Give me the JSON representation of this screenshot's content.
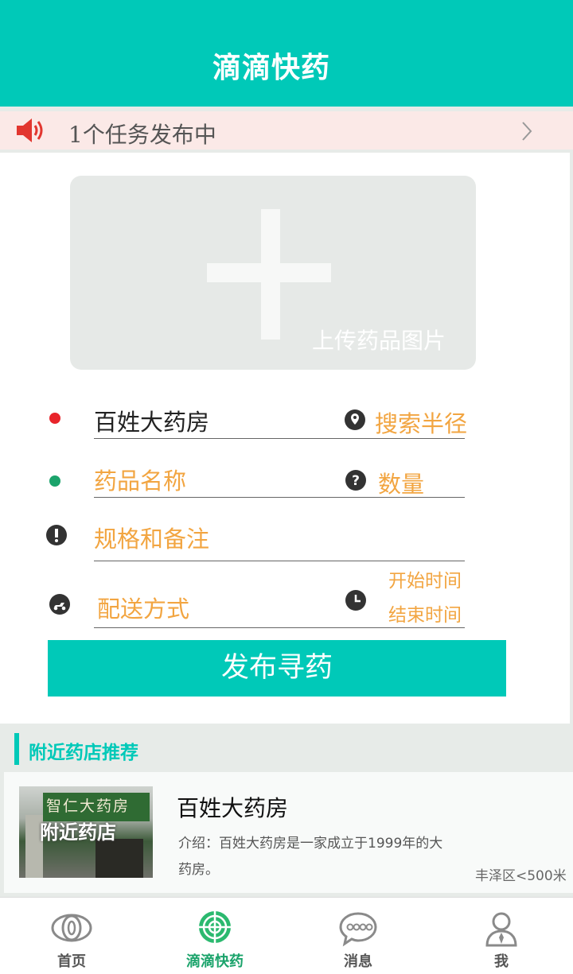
{
  "header": {
    "title": "滴滴快药"
  },
  "notice": {
    "text": "1个任务发布中"
  },
  "upload": {
    "label": "上传药品图片"
  },
  "form": {
    "pharmacy_value": "百姓大药房",
    "radius_placeholder": "搜索半径",
    "drug_name_placeholder": "药品名称",
    "quantity_placeholder": "数量",
    "spec_placeholder": "规格和备注",
    "delivery_placeholder": "配送方式",
    "start_time_placeholder": "开始时间",
    "end_time_placeholder": "结束时间",
    "publish_label": "发布寻药"
  },
  "colors": {
    "accent": "#00c9b8",
    "placeholder": "#f2a541",
    "red_dot": "#e8242a",
    "green_dot": "#1ba36b",
    "active_tab": "#1ba36b",
    "notice_bg": "#fbe9e7"
  },
  "nearby": {
    "section_title": "附近药店推荐",
    "stores": [
      {
        "photo_overlay": "附近药店",
        "photo_sign": "智仁大药房",
        "name": "百姓大药房",
        "intro": "介绍：百姓大药房是一家成立于1999年的大药房。",
        "distance": "丰泽区<500米"
      }
    ]
  },
  "tabbar": {
    "tabs": [
      {
        "label": "首页",
        "icon": "eye-icon",
        "active": false
      },
      {
        "label": "滴滴快药",
        "icon": "radar-icon",
        "active": true
      },
      {
        "label": "消息",
        "icon": "chat-bubble-icon",
        "active": false
      },
      {
        "label": "我",
        "icon": "user-icon",
        "active": false
      }
    ]
  }
}
